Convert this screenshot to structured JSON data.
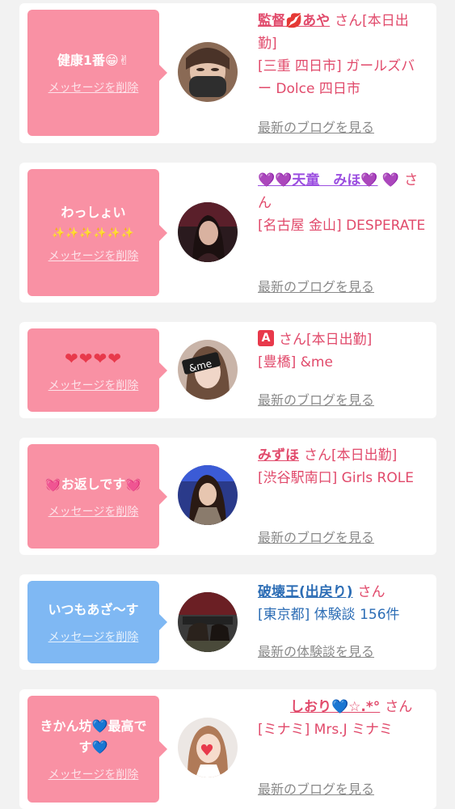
{
  "cards": [
    {
      "bubble_color": "#f991a4",
      "message_text": "健康1番",
      "message_emoji": "😁✌",
      "delete_label": "メッセージを削除",
      "name": "監督💋あや",
      "honorific": "さん",
      "status": "[本日出勤]",
      "shop": "[三重 四日市] ガールズバー Dolce 四日市",
      "link": "最新のブログを見る"
    },
    {
      "bubble_color": "#f991a4",
      "message_text": "わっしょい",
      "message_emoji": "✨✨✨✨✨✨",
      "delete_label": "メッセージを削除",
      "name": "💜💜天童　みほ💜",
      "name_tail": "💜",
      "honorific": "さん",
      "shop": "[名古屋 金山] DESPERATE",
      "link": "最新のブログを見る"
    },
    {
      "bubble_color": "#f991a4",
      "message_emoji": "❤❤❤❤",
      "delete_label": "メッセージを削除",
      "badge": "A",
      "honorific": "さん",
      "status": "[本日出勤]",
      "shop": "[豊橋] &me",
      "link": "最新のブログを見る"
    },
    {
      "bubble_color": "#f991a4",
      "message_text": "お返しです",
      "message_emoji": "💓",
      "delete_label": "メッセージを削除",
      "name": "みずほ",
      "honorific": "さん",
      "status": "[本日出勤]",
      "shop": "[渋谷駅南口] Girls ROLE",
      "link": "最新のブログを見る"
    },
    {
      "bubble_color": "#7fb8f3",
      "message_text": "いつもあざ〜す",
      "delete_label": "メッセージを削除",
      "name": "破壊王(出戻り)",
      "honorific": "さん",
      "shop": "[東京都] 体験談 156件",
      "link": "最新の体験談を見る"
    },
    {
      "bubble_color": "#f991a4",
      "message_text": "きかん坊💙最高です💙",
      "delete_label": "メッセージを削除",
      "name": "しおり💙☆.*°",
      "honorific": "さん",
      "shop": "[ミナミ] Mrs.J ミナミ",
      "link": "最新のブログを見る"
    }
  ],
  "avatar_overlay_text": "&me"
}
